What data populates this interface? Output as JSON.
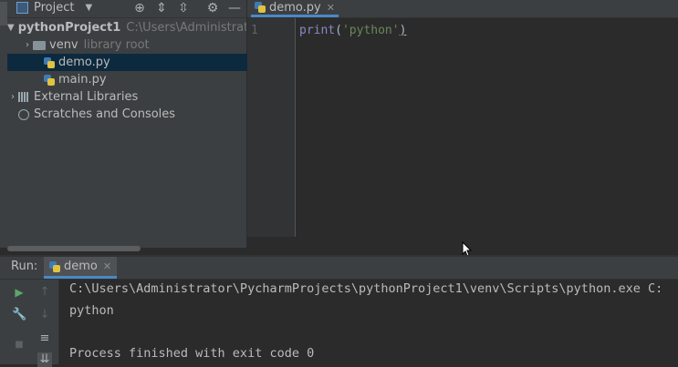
{
  "project_panel": {
    "title": "Project",
    "dropdown_icon": "chevron-down-icon",
    "header_icons": [
      "locate-icon",
      "expand-all-icon",
      "collapse-all-icon",
      "gear-icon",
      "minimize-icon"
    ]
  },
  "tree": {
    "root_name": "pythonProject1",
    "root_path": "C:\\Users\\Administrati",
    "venv_name": "venv",
    "venv_note": "library root",
    "file_demo": "demo.py",
    "file_main": "main.py",
    "external_libraries": "External Libraries",
    "scratches": "Scratches and Consoles"
  },
  "editor": {
    "tab_label": "demo.py",
    "line_number": "1",
    "code_fn": "print",
    "code_open": "(",
    "code_str": "'python'",
    "code_close": ")"
  },
  "run": {
    "label": "Run:",
    "tab_label": "demo",
    "console_line1": "C:\\Users\\Administrator\\PycharmProjects\\pythonProject1\\venv\\Scripts\\python.exe C:",
    "console_line2": "python",
    "console_line3": "",
    "console_line4": "Process finished with exit code 0"
  },
  "colors": {
    "accent": "#4a88c7",
    "selection": "#0d293e",
    "run_green": "#59a869"
  }
}
